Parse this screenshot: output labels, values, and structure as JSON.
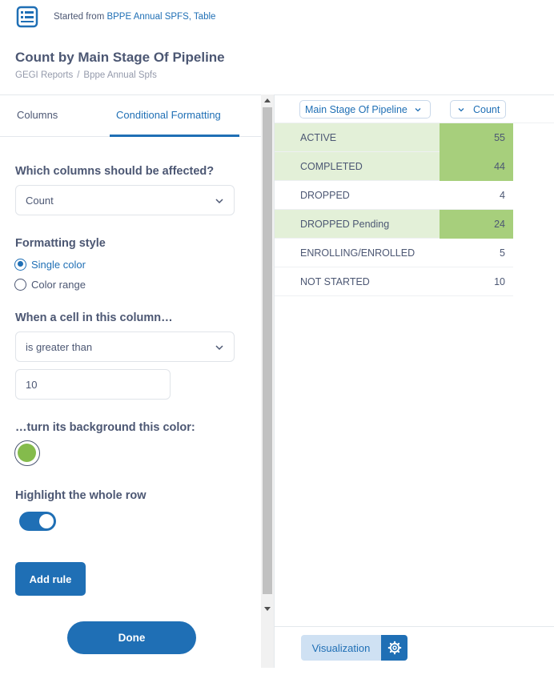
{
  "header": {
    "started_from_prefix": "Started from ",
    "source_link": "BPPE Annual SPFS, Table",
    "title": "Count by Main Stage Of Pipeline",
    "breadcrumb": [
      "GEGI Reports",
      "Bppe Annual Spfs"
    ],
    "breadcrumb_sep": "/"
  },
  "tabs": {
    "columns": "Columns",
    "conditional_formatting": "Conditional Formatting",
    "active": "conditional_formatting"
  },
  "form": {
    "columns_label": "Which columns should be affected?",
    "columns_value": "Count",
    "style_label": "Formatting style",
    "style_options": [
      "Single color",
      "Color range"
    ],
    "style_selected": "Single color",
    "condition_label": "When a cell in this column…",
    "condition_operator": "is greater than",
    "condition_value": "10",
    "color_label": "…turn its background this color:",
    "color": "#84bb4c",
    "highlight_row_label": "Highlight the whole row",
    "highlight_row_on": true,
    "add_rule": "Add rule",
    "done": "Done"
  },
  "table": {
    "columns": [
      "Main Stage Of Pipeline",
      "Count"
    ],
    "rows": [
      {
        "stage": "ACTIVE",
        "count": "55",
        "highlighted": true
      },
      {
        "stage": "COMPLETED",
        "count": "44",
        "highlighted": true
      },
      {
        "stage": "DROPPED",
        "count": "4",
        "highlighted": false
      },
      {
        "stage": "DROPPED Pending",
        "count": "24",
        "highlighted": true
      },
      {
        "stage": "ENROLLING/ENROLLED",
        "count": "5",
        "highlighted": false
      },
      {
        "stage": "NOT STARTED",
        "count": "10",
        "highlighted": false
      }
    ],
    "row_highlight_color": "#e3f0d8",
    "cell_highlight_color": "#a7cf7c"
  },
  "footer": {
    "visualization": "Visualization"
  },
  "colors": {
    "brand": "#1f6fb5",
    "text": "#4c5773"
  }
}
